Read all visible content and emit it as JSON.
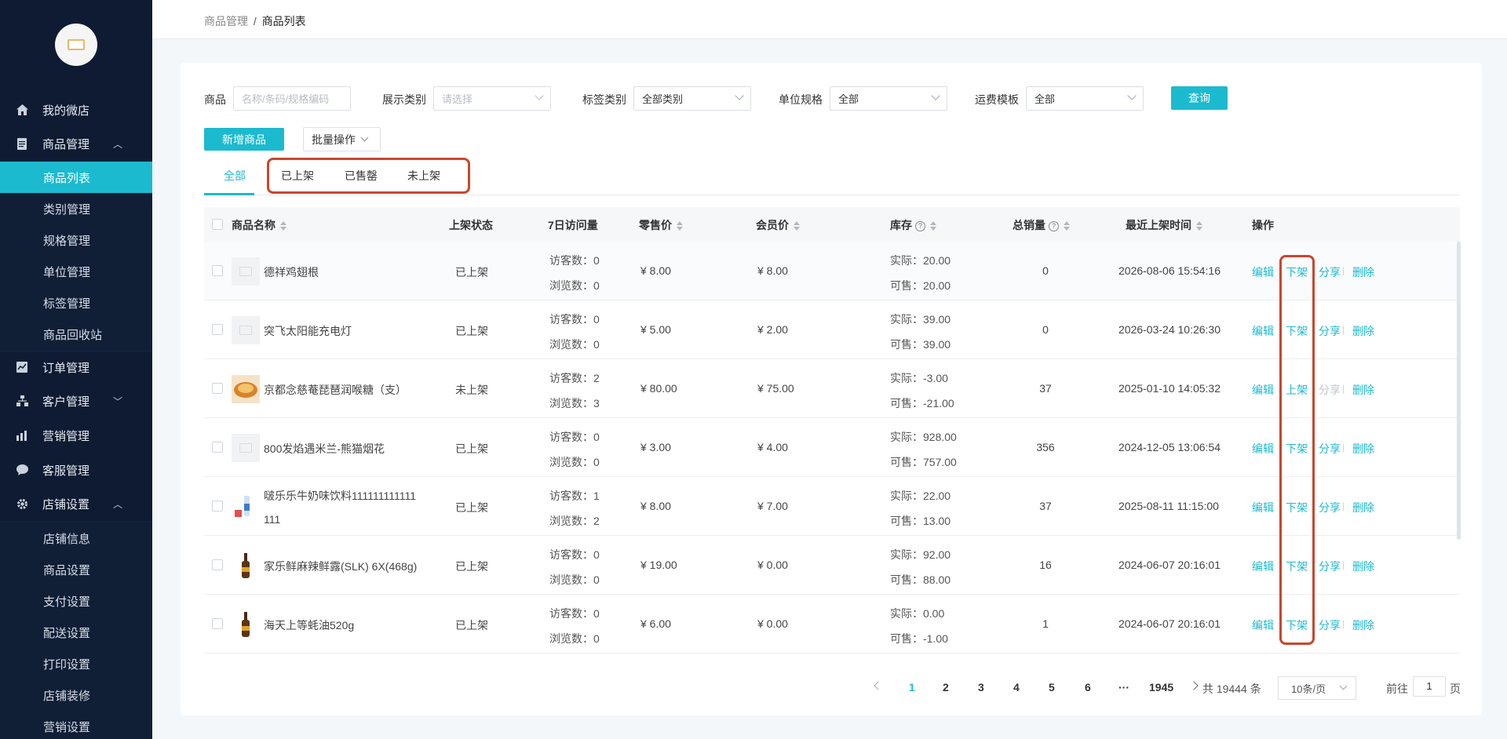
{
  "sidebar": {
    "items": [
      {
        "label": "我的微店",
        "icon": "home-icon"
      },
      {
        "label": "商品管理",
        "icon": "document-icon",
        "expanded": true
      },
      {
        "label": "订单管理",
        "icon": "chart-icon"
      },
      {
        "label": "客户管理",
        "icon": "org-icon"
      },
      {
        "label": "营销管理",
        "icon": "bars-icon"
      },
      {
        "label": "客服管理",
        "icon": "chat-icon"
      },
      {
        "label": "店铺设置",
        "icon": "gear-icon",
        "expanded": true
      }
    ],
    "goods_sub": [
      "商品列表",
      "类别管理",
      "规格管理",
      "单位管理",
      "标签管理",
      "商品回收站"
    ],
    "shop_sub": [
      "店铺信息",
      "商品设置",
      "支付设置",
      "配送设置",
      "打印设置",
      "店铺装修",
      "营销设置"
    ],
    "active": "商品列表"
  },
  "breadcrumb": {
    "parent": "商品管理",
    "sep": "/",
    "current": "商品列表"
  },
  "filters": {
    "goods_label": "商品",
    "goods_placeholder": "名称/条码/规格编码",
    "display_label": "展示类别",
    "display_placeholder": "请选择",
    "tag_label": "标签类别",
    "tag_value": "全部类别",
    "unit_label": "单位规格",
    "unit_value": "全部",
    "freight_label": "运费模板",
    "freight_value": "全部",
    "query_button": "查询"
  },
  "actions": {
    "add_button": "新增商品",
    "batch_button": "批量操作"
  },
  "tabs": [
    "全部",
    "已上架",
    "已售罄",
    "未上架"
  ],
  "table": {
    "headers": [
      "商品名称",
      "上架状态",
      "7日访问量",
      "零售价",
      "会员价",
      "库存",
      "总销量",
      "最近上架时间",
      "操作"
    ],
    "visitor_prefix": "访客数：",
    "view_prefix": "浏览数：",
    "actual_prefix": "实际：",
    "avail_prefix": "可售：",
    "rows": [
      {
        "name": "德祥鸡翅根",
        "name2": "",
        "status": "已上架",
        "visitors": "0",
        "views": "0",
        "retail": "¥ 8.00",
        "member": "¥ 8.00",
        "actual": "20.00",
        "avail": "20.00",
        "sales": "0",
        "time": "2026-08-06 15:54:16",
        "edit": "编辑",
        "toggle": "下架",
        "share": "分享",
        "del": "删除",
        "share_disabled": false,
        "thumb": "placeholder"
      },
      {
        "name": "突飞太阳能充电灯",
        "name2": "",
        "status": "已上架",
        "visitors": "0",
        "views": "0",
        "retail": "¥ 5.00",
        "member": "¥ 2.00",
        "actual": "39.00",
        "avail": "39.00",
        "sales": "0",
        "time": "2026-03-24 10:26:30",
        "edit": "编辑",
        "toggle": "下架",
        "share": "分享",
        "del": "删除",
        "share_disabled": false,
        "thumb": "placeholder"
      },
      {
        "name": "京都念慈菴琵琶润喉糖（支）",
        "name2": "",
        "status": "未上架",
        "visitors": "2",
        "views": "3",
        "retail": "¥ 80.00",
        "member": "¥ 75.00",
        "actual": "-3.00",
        "avail": "-21.00",
        "sales": "37",
        "time": "2025-01-10 14:05:32",
        "edit": "编辑",
        "toggle": "上架",
        "share": "分享",
        "del": "删除",
        "share_disabled": true,
        "thumb": "candy"
      },
      {
        "name": "800发焰遇米兰-熊猫烟花",
        "name2": "",
        "status": "已上架",
        "visitors": "0",
        "views": "0",
        "retail": "¥ 3.00",
        "member": "¥ 4.00",
        "actual": "928.00",
        "avail": "757.00",
        "sales": "356",
        "time": "2024-12-05 13:06:54",
        "edit": "编辑",
        "toggle": "下架",
        "share": "分享",
        "del": "删除",
        "share_disabled": false,
        "thumb": "placeholder"
      },
      {
        "name": "啵乐乐牛奶味饮料111111111111",
        "name2": "111",
        "status": "已上架",
        "visitors": "1",
        "views": "2",
        "retail": "¥ 8.00",
        "member": "¥ 7.00",
        "actual": "22.00",
        "avail": "13.00",
        "sales": "37",
        "time": "2025-08-11 11:15:00",
        "edit": "编辑",
        "toggle": "下架",
        "share": "分享",
        "del": "删除",
        "share_disabled": false,
        "thumb": "drink"
      },
      {
        "name": "家乐鲜麻辣鲜露(SLK) 6X(468g)",
        "name2": "",
        "status": "已上架",
        "visitors": "0",
        "views": "0",
        "retail": "¥ 19.00",
        "member": "¥ 0.00",
        "actual": "92.00",
        "avail": "88.00",
        "sales": "16",
        "time": "2024-06-07 20:16:01",
        "edit": "编辑",
        "toggle": "下架",
        "share": "分享",
        "del": "删除",
        "share_disabled": false,
        "thumb": "bottle"
      },
      {
        "name": "海天上等蚝油520g",
        "name2": "",
        "status": "已上架",
        "visitors": "0",
        "views": "0",
        "retail": "¥ 6.00",
        "member": "¥ 0.00",
        "actual": "0.00",
        "avail": "-1.00",
        "sales": "1",
        "time": "2024-06-07 20:16:01",
        "edit": "编辑",
        "toggle": "下架",
        "share": "分享",
        "del": "删除",
        "share_disabled": false,
        "thumb": "bottle"
      }
    ]
  },
  "pagination": {
    "pages": [
      "1",
      "2",
      "3",
      "4",
      "5",
      "6",
      "···",
      "1945"
    ],
    "current": "1",
    "total": "共 19444 条",
    "page_size": "10条/页",
    "goto_label": "前往",
    "goto_value": "1",
    "page_unit": "页"
  },
  "colors": {
    "accent": "#1cbacf",
    "sidebar": "#0e1b32",
    "highlight": "#c8472d"
  }
}
